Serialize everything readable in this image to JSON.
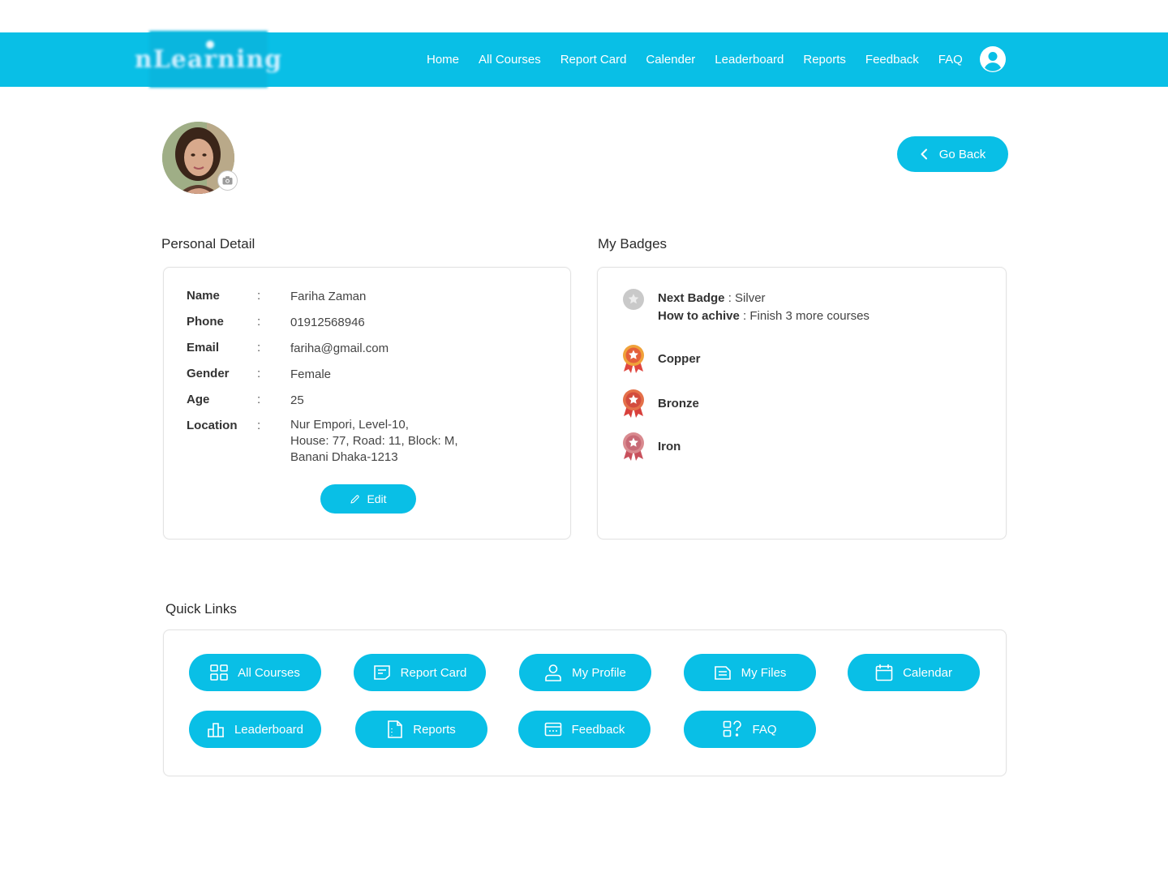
{
  "header": {
    "logo_text": "nLearning",
    "nav": [
      "Home",
      "All Courses",
      "Report Card",
      "Calender",
      "Leaderboard",
      "Reports",
      "Feedback",
      "FAQ"
    ]
  },
  "actions": {
    "go_back": "Go Back",
    "edit": "Edit"
  },
  "personal": {
    "title": "Personal Detail",
    "separator": ":",
    "fields": [
      {
        "label": "Name",
        "value": "Fariha Zaman"
      },
      {
        "label": "Phone",
        "value": "01912568946"
      },
      {
        "label": "Email",
        "value": "fariha@gmail.com"
      },
      {
        "label": "Gender",
        "value": "Female"
      },
      {
        "label": "Age",
        "value": "25"
      },
      {
        "label": "Location",
        "value_lines": [
          "Nur Empori, Level-10,",
          "House: 77, Road: 11, Block: M,",
          "Banani Dhaka-1213"
        ]
      }
    ]
  },
  "badges": {
    "title": "My Badges",
    "next_label": "Next Badge",
    "next_value": " : Silver",
    "how_label": "How to achive",
    "how_value": " : Finish 3 more courses",
    "earned": [
      {
        "name": "Copper",
        "color": "#f0a23a"
      },
      {
        "name": "Bronze",
        "color": "#e4714a"
      },
      {
        "name": "Iron",
        "color": "#d98a8f"
      }
    ]
  },
  "quick_links": {
    "title": "Quick Links",
    "items": [
      {
        "label": "All Courses",
        "icon": "grid-icon"
      },
      {
        "label": "Report Card",
        "icon": "report-card-icon"
      },
      {
        "label": "My Profile",
        "icon": "user-icon"
      },
      {
        "label": "My Files",
        "icon": "file-icon"
      },
      {
        "label": "Calendar",
        "icon": "calendar-icon"
      },
      {
        "label": "Leaderboard",
        "icon": "leaderboard-icon"
      },
      {
        "label": "Reports",
        "icon": "reports-icon"
      },
      {
        "label": "Feedback",
        "icon": "feedback-icon"
      },
      {
        "label": "FAQ",
        "icon": "faq-icon"
      }
    ]
  },
  "colors": {
    "brand": "#09bfe6",
    "border": "#e3e3e3"
  }
}
